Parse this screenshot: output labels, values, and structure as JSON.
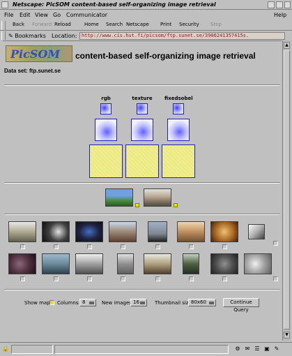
{
  "window": {
    "title": "Netscape: PicSOM content-based self-organizing image retrieval"
  },
  "menu": [
    "File",
    "Edit",
    "View",
    "Go",
    "Communicator",
    "Help"
  ],
  "toolbar": {
    "back": "Back",
    "forward": "Forward",
    "reload": "Reload",
    "home": "Home",
    "search": "Search",
    "netscape": "Netscape",
    "print": "Print",
    "security": "Security",
    "stop": "Stop"
  },
  "location": {
    "bookmarks_label": "Bookmarks",
    "location_label": "Location:",
    "url": "http://www.cis.hut.fi/picsom/ftp.sunet.se/3906241357415s."
  },
  "page": {
    "logo_text": "PicSOM",
    "heading": "content-based self-organizing image retrieval",
    "dataset": "Data set: ftp.sunet.se",
    "features": [
      "rgb",
      "texture",
      "fixedsobel"
    ]
  },
  "controls": {
    "show_maps_label": "Show maps:",
    "columns_label": "Columns:",
    "columns_value": "8",
    "new_images_label": "New images:",
    "new_images_value": "16",
    "thumb_size_label": "Thumbnail size:",
    "thumb_size_value": "80x60",
    "continue_label": "Continue Query"
  },
  "colors": {
    "url_text": "#8a1c1c",
    "som_border": "#2020c0",
    "query_marker": "#f0e000"
  }
}
